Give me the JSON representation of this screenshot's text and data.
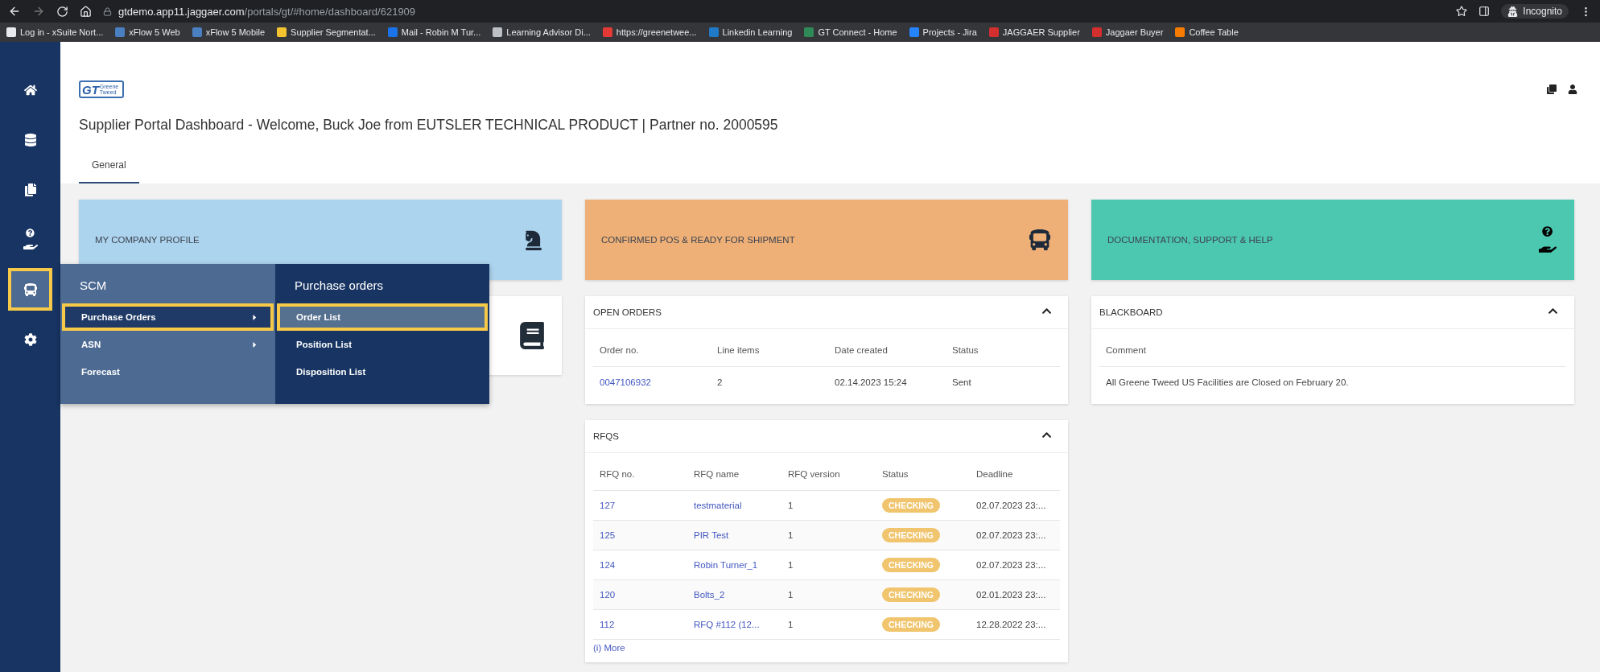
{
  "browser": {
    "url_host": "gtdemo.app11.jaggaer.com",
    "url_path": "/portals/gt/#home/dashboard/621909",
    "profile": "Incognito",
    "bookmarks": [
      {
        "label": "Log in - xSuite Nort...",
        "color": "#e8eaed"
      },
      {
        "label": "xFlow 5 Web",
        "color": "#4a7fc1"
      },
      {
        "label": "xFlow 5 Mobile",
        "color": "#4a7fc1"
      },
      {
        "label": "Supplier Segmentat...",
        "color": "#f4c430"
      },
      {
        "label": "Mail - Robin M Tur...",
        "color": "#1a73e8"
      },
      {
        "label": "Learning Advisor Di...",
        "color": "#bdc1c6"
      },
      {
        "label": "https://greenetwee...",
        "color": "#e53935"
      },
      {
        "label": "Linkedin Learning",
        "color": "#1f7ac7"
      },
      {
        "label": "GT Connect - Home",
        "color": "#2e8b57"
      },
      {
        "label": "Projects - Jira",
        "color": "#2684ff"
      },
      {
        "label": "JAGGAER Supplier",
        "color": "#d32f2f"
      },
      {
        "label": "Jaggaer Buyer",
        "color": "#d32f2f"
      },
      {
        "label": "Coffee Table",
        "color": "#f57c00"
      }
    ]
  },
  "sidebar": {
    "items": [
      {
        "selected": false
      },
      {
        "selected": false
      },
      {
        "selected": false
      },
      {
        "selected": false
      },
      {
        "selected": true
      },
      {
        "selected": false
      }
    ]
  },
  "logo": {
    "mark": "GT",
    "name": "Greene Tweed"
  },
  "title": "Supplier Portal Dashboard - Welcome, Buck Joe from EUTSLER TECHNICAL PRODUCT | Partner no. 2000595",
  "tabs": [
    {
      "label": "General",
      "selected": true
    }
  ],
  "tiles": [
    {
      "label": "MY COMPANY PROFILE",
      "color": "#add4ee"
    },
    {
      "label": "CONFIRMED POS & READY FOR SHIPMENT",
      "color": "#eeb077"
    },
    {
      "label": "DOCUMENTATION, SUPPORT & HELP",
      "color": "#4cc7b0"
    }
  ],
  "open_orders": {
    "title": "OPEN ORDERS",
    "expanded": true,
    "columns": [
      "Order no.",
      "Line items",
      "Date created",
      "Status"
    ],
    "rows": [
      [
        "0047106932",
        "2",
        "02.14.2023 15:24",
        "Sent"
      ]
    ]
  },
  "rfqs": {
    "title": "RFQS",
    "expanded": true,
    "columns": [
      "RFQ no.",
      "RFQ name",
      "RFQ version",
      "Status",
      "Deadline"
    ],
    "rows": [
      {
        "no": "127",
        "name": "testmaterial",
        "version": "1",
        "status": "CHECKING",
        "deadline": "02.07.2023 23:..."
      },
      {
        "no": "125",
        "name": "PIR Test",
        "version": "1",
        "status": "CHECKING",
        "deadline": "02.07.2023 23:..."
      },
      {
        "no": "124",
        "name": "Robin Turner_1",
        "version": "1",
        "status": "CHECKING",
        "deadline": "02.07.2023 23:..."
      },
      {
        "no": "120",
        "name": "Bolts_2",
        "version": "1",
        "status": "CHECKING",
        "deadline": "02.01.2023 23:..."
      },
      {
        "no": "112",
        "name": "RFQ #112 (12...",
        "version": "1",
        "status": "CHECKING",
        "deadline": "12.28.2022 23:..."
      }
    ],
    "more": "(i) More"
  },
  "blackboard": {
    "title": "BLACKBOARD",
    "expanded": true,
    "columns": [
      "Comment"
    ],
    "rows": [
      [
        "All Greene Tweed US Facilities are Closed on February 20."
      ]
    ]
  },
  "flyout": {
    "title": "SCM",
    "items": [
      {
        "label": "Purchase Orders",
        "submenu": true,
        "selected": true
      },
      {
        "label": "ASN",
        "submenu": true,
        "selected": false
      },
      {
        "label": "Forecast",
        "submenu": false,
        "selected": false
      }
    ],
    "subtitle": "Purchase orders",
    "subitems": [
      {
        "label": "Order List",
        "selected": true
      },
      {
        "label": "Position List",
        "selected": false
      },
      {
        "label": "Disposition List",
        "selected": false
      }
    ]
  }
}
